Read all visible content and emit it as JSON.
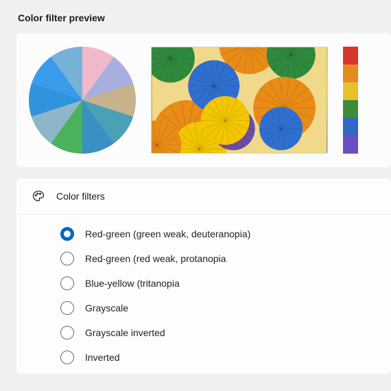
{
  "preview": {
    "title": "Color filter preview",
    "swatch_colors": [
      "#d9352b",
      "#e38b1f",
      "#e5c22c",
      "#3f8b3a",
      "#2f68c8",
      "#6a4fc1"
    ]
  },
  "filters": {
    "header_label": "Color filters",
    "selected_index": 0,
    "options": [
      {
        "label": "Red-green (green weak, deuteranopia)"
      },
      {
        "label": "Red-green (red weak, protanopia"
      },
      {
        "label": "Blue-yellow (tritanopia"
      },
      {
        "label": "Grayscale"
      },
      {
        "label": "Grayscale inverted"
      },
      {
        "label": "Inverted"
      }
    ]
  }
}
